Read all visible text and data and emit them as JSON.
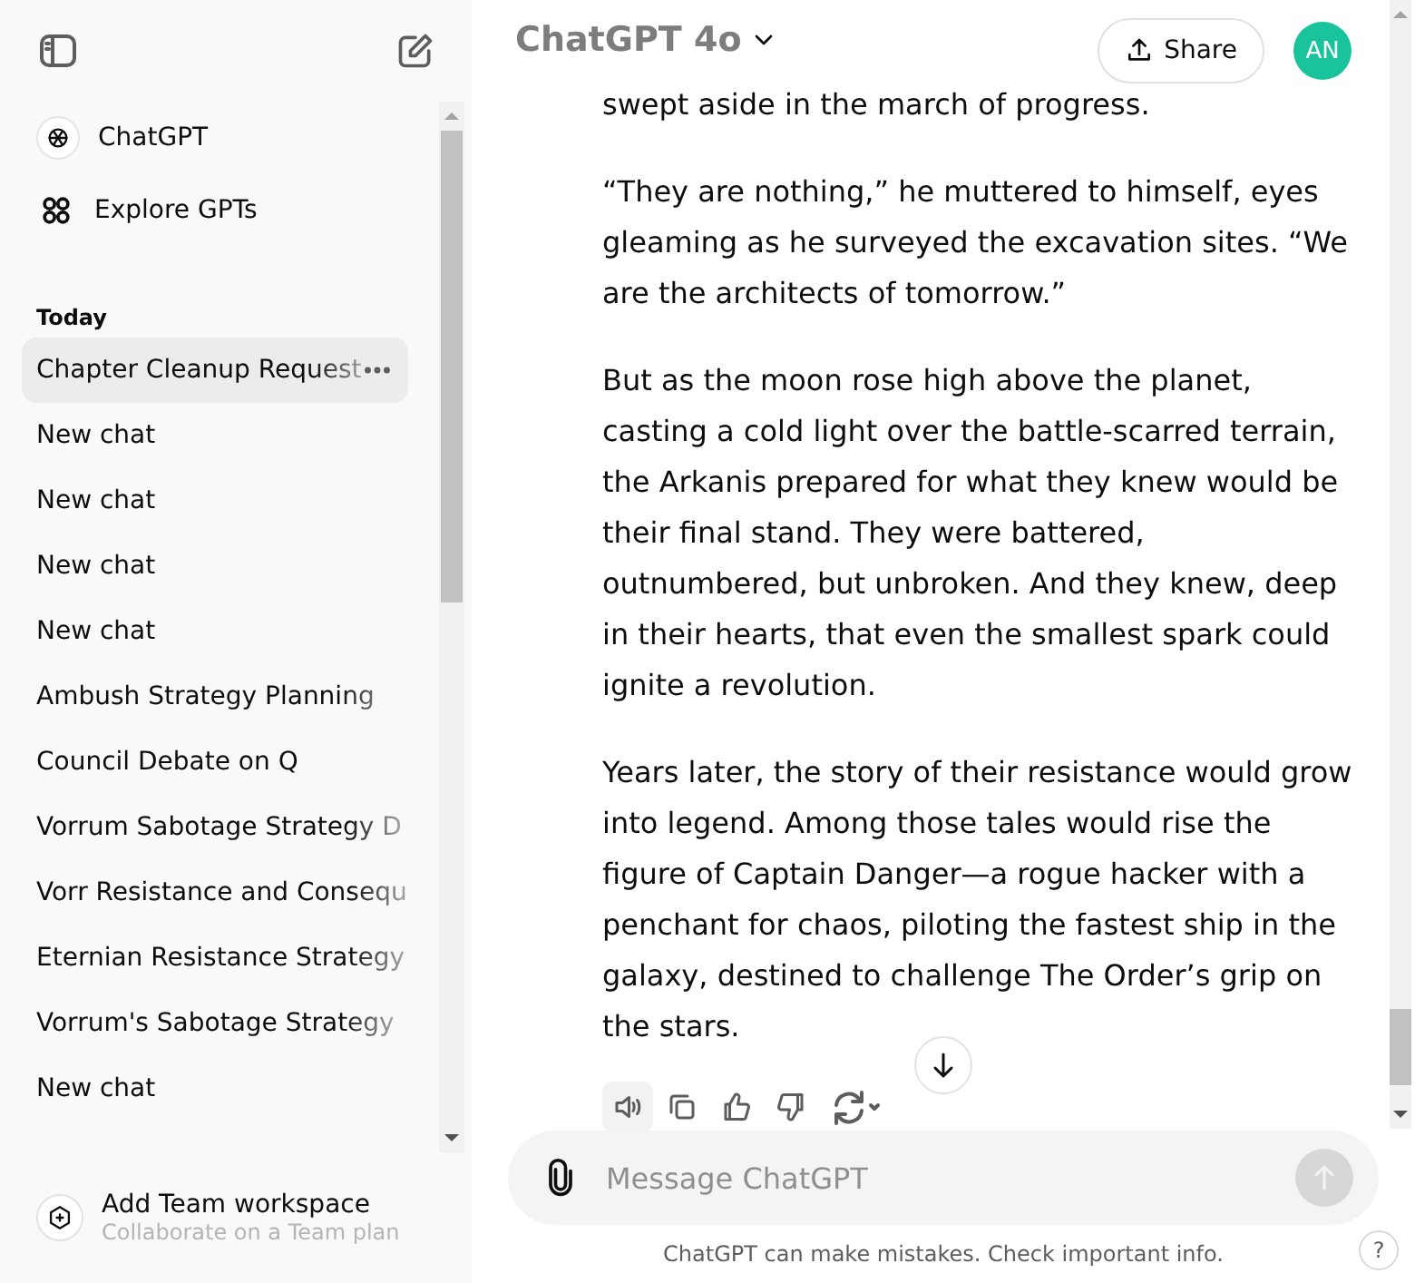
{
  "sidebar": {
    "nav": [
      {
        "label": "ChatGPT",
        "kind": "logo"
      },
      {
        "label": "Explore GPTs",
        "kind": "grid"
      }
    ],
    "section": "Today",
    "chats": [
      {
        "title": "Chapter Cleanup Request",
        "selected": true
      },
      {
        "title": "New chat",
        "selected": false
      },
      {
        "title": "New chat",
        "selected": false
      },
      {
        "title": "New chat",
        "selected": false
      },
      {
        "title": "New chat",
        "selected": false
      },
      {
        "title": "Ambush Strategy Planning",
        "selected": false
      },
      {
        "title": "Council Debate on Q",
        "selected": false
      },
      {
        "title": "Vorrum Sabotage Strategy D",
        "selected": false
      },
      {
        "title": "Vorr Resistance and Consequ",
        "selected": false
      },
      {
        "title": "Eternian Resistance Strategy",
        "selected": false
      },
      {
        "title": "Vorrum's Sabotage Strategy",
        "selected": false
      },
      {
        "title": "New chat",
        "selected": false
      }
    ],
    "footer": {
      "title": "Add Team workspace",
      "subtitle": "Collaborate on a Team plan"
    }
  },
  "header": {
    "model": "ChatGPT 4o",
    "share": "Share",
    "avatar": "AN"
  },
  "message": {
    "paragraphs": [
      "swept aside in the march of progress.",
      "“They are nothing,” he muttered to himself, eyes gleaming as he surveyed the excavation sites. “We are the architects of tomorrow.”",
      "But as the moon rose high above the planet, casting a cold light over the battle-scarred terrain, the Arkanis prepared for what they knew would be their final stand. They were battered, outnumbered, but unbroken. And they knew, deep in their hearts, that even the smallest spark could ignite a revolution.",
      "Years later, the story of their resistance would grow into legend. Among those tales would rise the figure of Captain Danger—a rogue hacker with a penchant for chaos, piloting the fastest ship in the galaxy, destined to challenge The Order’s grip on the stars."
    ]
  },
  "composer": {
    "placeholder": "Message ChatGPT"
  },
  "disclaimer": "ChatGPT can make mistakes. Check important info.",
  "help": "?"
}
